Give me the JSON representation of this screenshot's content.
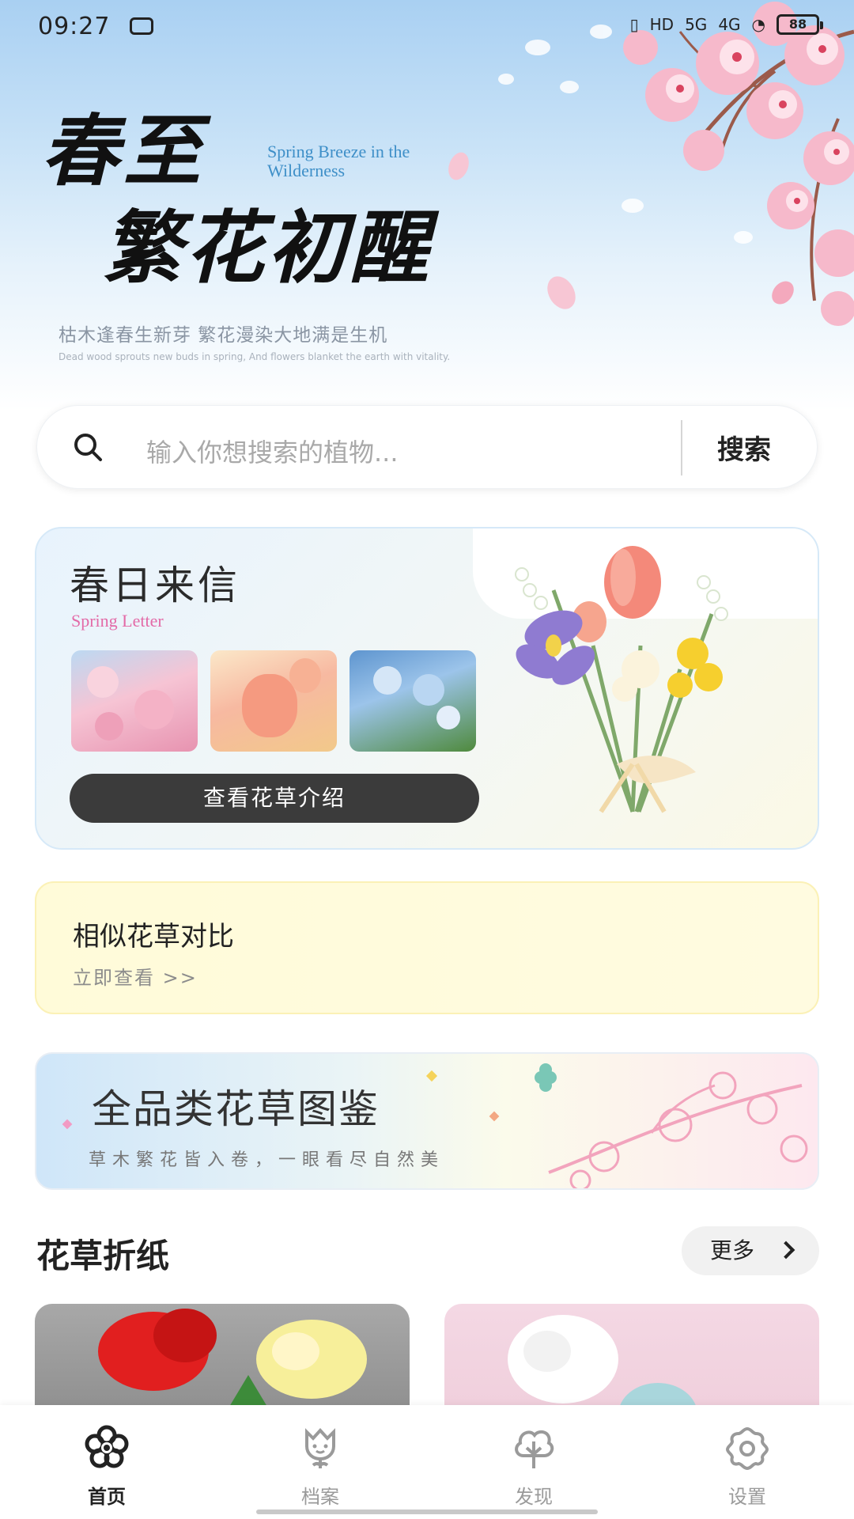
{
  "status_bar": {
    "time": "09:27",
    "network_labels": [
      "HD",
      "5G",
      "4G"
    ],
    "battery": "88"
  },
  "hero": {
    "title_line1": "春至",
    "title_line2": "繁花初醒",
    "title_en": "Spring Breeze in the Wilderness",
    "subtitle_cn": "枯木逢春生新芽 繁花漫染大地满是生机",
    "subtitle_en": "Dead wood sprouts new buds in spring, And flowers blanket the earth with vitality."
  },
  "search": {
    "placeholder": "输入你想搜索的植物...",
    "button_label": "搜索",
    "icon": "search-icon"
  },
  "spring_letter": {
    "title": "春日来信",
    "subtitle": "Spring Letter",
    "thumbnails": [
      "cherry-blossom",
      "tulip",
      "blue-flowers"
    ],
    "button_label": "查看花草介绍"
  },
  "compare": {
    "title": "相似花草对比",
    "link_label": "立即查看 >>"
  },
  "catalog": {
    "title": "全品类花草图鉴",
    "subtitle": "草木繁花皆入卷，一眼看尽自然美"
  },
  "origami_section": {
    "title": "花草折纸",
    "more_label": "更多"
  },
  "tab_bar": {
    "items": [
      {
        "label": "首页",
        "icon": "flower-icon",
        "active": true
      },
      {
        "label": "档案",
        "icon": "tulip-icon",
        "active": false
      },
      {
        "label": "发现",
        "icon": "tree-icon",
        "active": false
      },
      {
        "label": "设置",
        "icon": "gear-icon",
        "active": false
      }
    ]
  },
  "colors": {
    "accent_pink": "#e36aa7",
    "hero_blue": "#a9d0f2",
    "button_dark": "#3b3b3b",
    "compare_yellow": "#fffbd9"
  }
}
